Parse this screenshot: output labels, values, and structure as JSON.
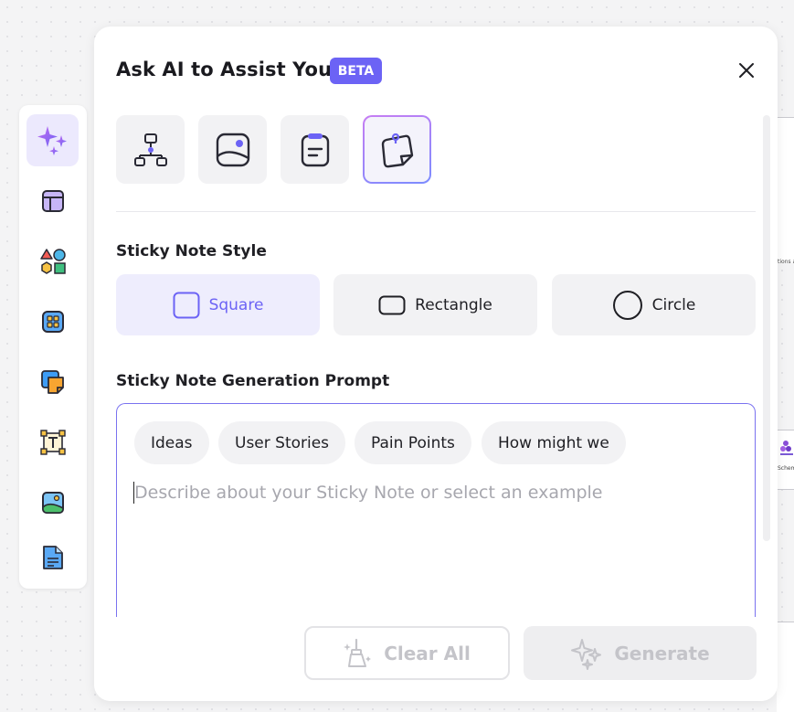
{
  "panel": {
    "title": "Ask AI to Assist You",
    "badge": "BETA",
    "modes": [
      {
        "icon": "flowchart-icon"
      },
      {
        "icon": "image-icon"
      },
      {
        "icon": "notepad-icon"
      },
      {
        "icon": "sticky-note-icon",
        "active": true
      }
    ],
    "style_section": {
      "label": "Sticky Note Style",
      "options": [
        {
          "label": "Square",
          "icon": "square-shape-icon",
          "selected": true
        },
        {
          "label": "Rectangle",
          "icon": "rectangle-shape-icon"
        },
        {
          "label": "Circle",
          "icon": "circle-shape-icon"
        }
      ]
    },
    "prompt_section": {
      "label": "Sticky Note Generation Prompt",
      "chips": [
        "Ideas",
        "User Stories",
        "Pain Points",
        "How might we"
      ],
      "placeholder": "Describe about your Sticky Note or select an example"
    },
    "footer": {
      "clear_label": "Clear All",
      "generate_label": "Generate"
    }
  },
  "toolbar": {
    "items": [
      {
        "icon": "ai-sparkle-icon",
        "active": true
      },
      {
        "icon": "template-icon"
      },
      {
        "icon": "shapes-icon"
      },
      {
        "icon": "components-icon"
      },
      {
        "icon": "sticky-notes-icon"
      },
      {
        "icon": "text-icon"
      },
      {
        "icon": "image-icon"
      },
      {
        "icon": "document-icon"
      }
    ]
  },
  "colors": {
    "accent": "#6c63f5",
    "selected_bg": "#eeedfd",
    "chip_bg": "#f2f2f4"
  }
}
